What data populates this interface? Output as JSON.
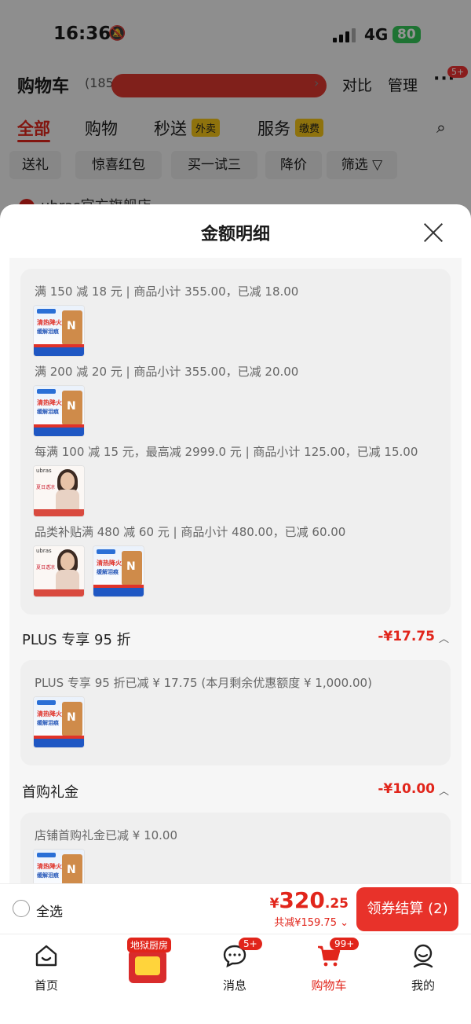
{
  "status_bar": {
    "time": "16:36",
    "network": "4G",
    "battery": "80"
  },
  "cart_header": {
    "title": "购物车",
    "count_prefix": "(185",
    "chevron": "›",
    "compare": "对比",
    "manage": "管理",
    "more": "···",
    "more_badge": "5+"
  },
  "tabs": [
    {
      "label": "全部",
      "badge": ""
    },
    {
      "label": "购物",
      "badge": ""
    },
    {
      "label": "秒送",
      "badge": "外卖"
    },
    {
      "label": "服务",
      "badge": "缴费"
    }
  ],
  "filter_chips": [
    "送礼",
    "惊喜红包",
    "买一试三",
    "降价",
    "筛选 ▽"
  ],
  "store_peek": "ubras官方旗舰店",
  "sheet": {
    "title": "金额明细",
    "promotions": [
      {
        "text": "满 150 减 18 元 | 商品小计 355.00，已减 18.00"
      },
      {
        "text": "满 200 减 20 元 | 商品小计 355.00，已减 20.00"
      },
      {
        "text": "每满 100 减 15 元，最高减 2999.0 元 | 商品小计 125.00，已减 15.00"
      },
      {
        "text": "品类补贴满 480 减 60 元 | 商品小计 480.00，已减 60.00"
      }
    ],
    "plus": {
      "label": "PLUS 专享 95 折",
      "amount": "-¥17.75",
      "detail": "PLUS 专享 95 折已减 ¥ 17.75 (本月剩余优惠额度 ¥ 1,000.00)"
    },
    "first_gift": {
      "label": "首购礼金",
      "amount": "-¥10.00",
      "detail": "店铺首购礼金已减 ¥ 10.00"
    }
  },
  "checkout": {
    "select_all": "全选",
    "currency": "¥",
    "price_int": "320",
    "price_dec": ".25",
    "saved": "共减¥159.75 ⌄",
    "button": "领券结算 (2)"
  },
  "nav": {
    "home": "首页",
    "promo_tag": "地狱厨房",
    "messages": "消息",
    "messages_badge": "5+",
    "cart": "购物车",
    "cart_badge": "99+",
    "me": "我的"
  },
  "colors": {
    "accent": "#e1251b",
    "checkout_button": "#e8322a",
    "battery": "#34c759"
  }
}
